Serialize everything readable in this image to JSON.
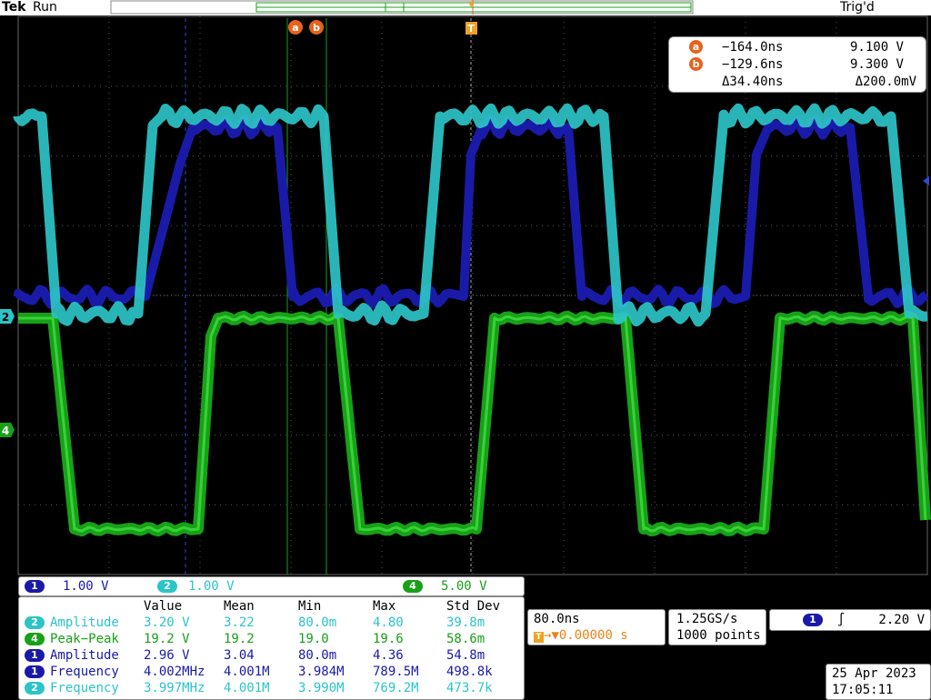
{
  "top_bar": {
    "brand": "Tek",
    "state": "Run",
    "trigger_status": "Trig'd"
  },
  "colors": {
    "ch1": "#1a1aa8",
    "ch2": "#2cc4c8",
    "ch4": "#18a018",
    "cursor": "#e8621c",
    "background": "#000000",
    "grid": "#555555"
  },
  "markers": {
    "cursor_a": "a",
    "cursor_b": "b",
    "trigger": "T",
    "ch2_level": "2",
    "ch4_level": "4"
  },
  "cursors": {
    "a": {
      "label": "a",
      "time": "−164.0ns",
      "voltage": "9.100 V"
    },
    "b": {
      "label": "b",
      "time": "−129.6ns",
      "voltage": "9.300 V"
    },
    "delta": {
      "time": "Δ34.40ns",
      "voltage": "Δ200.0mV"
    }
  },
  "channels": [
    {
      "num": "1",
      "scale": "1.00 V",
      "color": "#1a1aa8"
    },
    {
      "num": "2",
      "scale": "1.00 V",
      "color": "#2cc4c8"
    },
    {
      "num": "4",
      "scale": "5.00 V",
      "color": "#18a018"
    }
  ],
  "measurements": {
    "headers": [
      "Value",
      "Mean",
      "Min",
      "Max",
      "Std Dev"
    ],
    "rows": [
      {
        "ch": "2",
        "name": "Amplitude",
        "value": "3.20 V",
        "mean": "3.22",
        "min": "80.0m",
        "max": "4.80",
        "std": "39.8m"
      },
      {
        "ch": "4",
        "name": "Peak−Peak",
        "value": "19.2 V",
        "mean": "19.2",
        "min": "19.0",
        "max": "19.6",
        "std": "58.6m"
      },
      {
        "ch": "1",
        "name": "Amplitude",
        "value": "2.96 V",
        "mean": "3.04",
        "min": "80.0m",
        "max": "4.36",
        "std": "54.8m"
      },
      {
        "ch": "1",
        "name": "Frequency",
        "value": "4.002MHz",
        "mean": "4.001M",
        "min": "3.984M",
        "max": "789.5M",
        "std": "498.8k"
      },
      {
        "ch": "2",
        "name": "Frequency",
        "value": "3.997MHz",
        "mean": "4.001M",
        "min": "3.990M",
        "max": "769.2M",
        "std": "473.7k"
      }
    ]
  },
  "timebase": {
    "scale": "80.0ns",
    "position": "0.00000 s"
  },
  "acquisition": {
    "sample_rate": "1.25GS/s",
    "record_length": "1000 points"
  },
  "trigger": {
    "source": "1",
    "slope": "rising",
    "slope_glyph": "∫",
    "level": "2.20 V"
  },
  "datetime": {
    "date": "25 Apr 2023",
    "time": "17:05:11"
  }
}
